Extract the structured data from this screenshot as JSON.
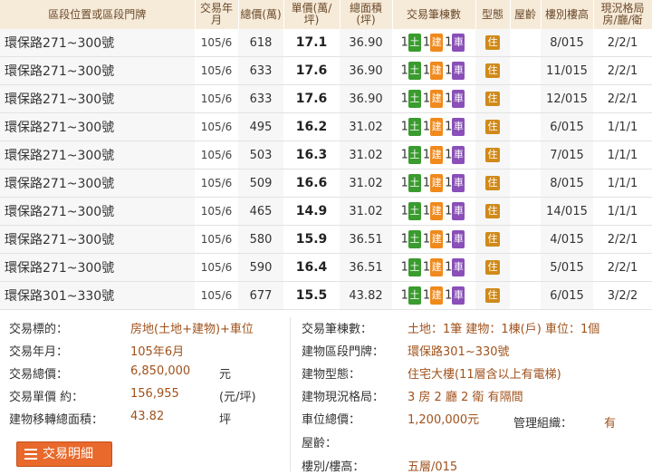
{
  "table": {
    "headers": {
      "location": "區段位置或區段門牌",
      "date": "交易年月",
      "total": "總價(萬)",
      "unit": "單價(萬/坪)",
      "area": "總面積(坪)",
      "counts": "交易筆棟數",
      "type": "型態",
      "age": "屋齡",
      "floor": "樓別樓高",
      "layout": "現況格局房/廳/衛"
    },
    "badges": {
      "land": "土",
      "building": "建",
      "car": "車",
      "type": "住"
    },
    "rows": [
      {
        "location": "環保路271~300號",
        "date": "105/6",
        "total": "618",
        "unit": "17.1",
        "area": "36.90",
        "land": "1",
        "building": "1",
        "car": "1",
        "floor": "8/015",
        "layout": "2/2/1"
      },
      {
        "location": "環保路271~300號",
        "date": "105/6",
        "total": "633",
        "unit": "17.6",
        "area": "36.90",
        "land": "1",
        "building": "1",
        "car": "1",
        "floor": "11/015",
        "layout": "2/2/1"
      },
      {
        "location": "環保路271~300號",
        "date": "105/6",
        "total": "633",
        "unit": "17.6",
        "area": "36.90",
        "land": "1",
        "building": "1",
        "car": "1",
        "floor": "12/015",
        "layout": "2/2/1"
      },
      {
        "location": "環保路271~300號",
        "date": "105/6",
        "total": "495",
        "unit": "16.2",
        "area": "31.02",
        "land": "1",
        "building": "1",
        "car": "1",
        "floor": "6/015",
        "layout": "1/1/1"
      },
      {
        "location": "環保路271~300號",
        "date": "105/6",
        "total": "503",
        "unit": "16.3",
        "area": "31.02",
        "land": "1",
        "building": "1",
        "car": "1",
        "floor": "7/015",
        "layout": "1/1/1"
      },
      {
        "location": "環保路271~300號",
        "date": "105/6",
        "total": "509",
        "unit": "16.6",
        "area": "31.02",
        "land": "1",
        "building": "1",
        "car": "1",
        "floor": "8/015",
        "layout": "1/1/1"
      },
      {
        "location": "環保路271~300號",
        "date": "105/6",
        "total": "465",
        "unit": "14.9",
        "area": "31.02",
        "land": "1",
        "building": "1",
        "car": "1",
        "floor": "14/015",
        "layout": "1/1/1"
      },
      {
        "location": "環保路271~300號",
        "date": "105/6",
        "total": "580",
        "unit": "15.9",
        "area": "36.51",
        "land": "1",
        "building": "1",
        "car": "1",
        "floor": "4/015",
        "layout": "2/2/1"
      },
      {
        "location": "環保路271~300號",
        "date": "105/6",
        "total": "590",
        "unit": "16.4",
        "area": "36.51",
        "land": "1",
        "building": "1",
        "car": "1",
        "floor": "5/015",
        "layout": "2/2/1"
      },
      {
        "location": "環保路301~330號",
        "date": "105/6",
        "total": "677",
        "unit": "15.5",
        "area": "43.82",
        "land": "1",
        "building": "1",
        "car": "1",
        "floor": "6/015",
        "layout": "3/2/2"
      }
    ]
  },
  "detail": {
    "left": [
      {
        "label": "交易標的：",
        "value": "房地(土地+建物)+車位",
        "unit": ""
      },
      {
        "label": "交易年月：",
        "value": "105年6月",
        "unit": ""
      },
      {
        "label": "交易總價：",
        "value": "6,850,000",
        "unit": "元"
      },
      {
        "label": "交易單價 約：",
        "value": "156,955",
        "unit": "(元/坪)"
      },
      {
        "label": "建物移轉總面積：",
        "value": "43.82",
        "unit": "坪"
      }
    ],
    "right": [
      {
        "label": "交易筆棟數：",
        "value": "土地：1筆 建物：1棟(戶) 車位：1個"
      },
      {
        "label": "建物區段門牌：",
        "value": "環保路301~330號"
      },
      {
        "label": "建物型態：",
        "value": "住宅大樓(11層含以上有電梯)"
      },
      {
        "label": "建物現況格局：",
        "value": "3 房 2 廳 2 衛 有隔間"
      },
      {
        "label": "車位總價：",
        "value": "1,200,000元"
      },
      {
        "label": "屋齡：",
        "value": ""
      },
      {
        "label": "樓別/樓高：",
        "value": "五層/015"
      }
    ],
    "management_label": "管理組織：",
    "management_value": "有",
    "button_label": "交易明細"
  }
}
